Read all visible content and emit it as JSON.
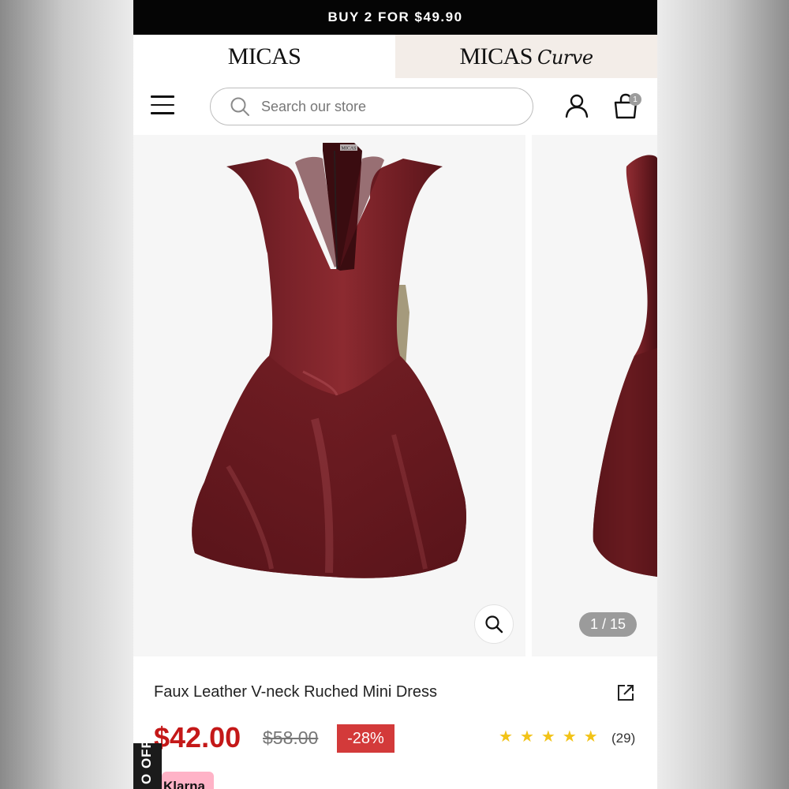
{
  "promo_banner": {
    "text": "BUY 2 FOR $49.90"
  },
  "brand_tabs": [
    {
      "label": "MICAS"
    },
    {
      "label": "MICAS",
      "script": "Curve"
    }
  ],
  "header": {
    "search_placeholder": "Search our store",
    "cart_count": "1",
    "icons": {
      "menu": "hamburger-menu-icon",
      "search": "search-icon",
      "account": "user-icon",
      "cart": "shopping-bag-icon"
    }
  },
  "gallery": {
    "counter": "1 / 15",
    "product_tag_text": "MICAS",
    "product_color": "#6e1c22",
    "icons": {
      "zoom": "zoom-icon"
    }
  },
  "product": {
    "title": "Faux Leather V-neck Ruched Mini Dress",
    "price": "$42.00",
    "original_price": "$58.00",
    "discount": "-28%",
    "rating_stars": 5,
    "reviews": "(29)",
    "icons": {
      "share": "share-icon",
      "star": "star-icon"
    }
  },
  "side_tab": {
    "text": "O OFF"
  },
  "payment_badge": {
    "text": "Klarna"
  },
  "colors": {
    "price_red": "#c41818",
    "discount_bg": "#d33a3a",
    "star_yellow": "#f2c318",
    "curve_tab_bg": "#f3ede8",
    "klarna_pink": "#ffb3c7"
  }
}
